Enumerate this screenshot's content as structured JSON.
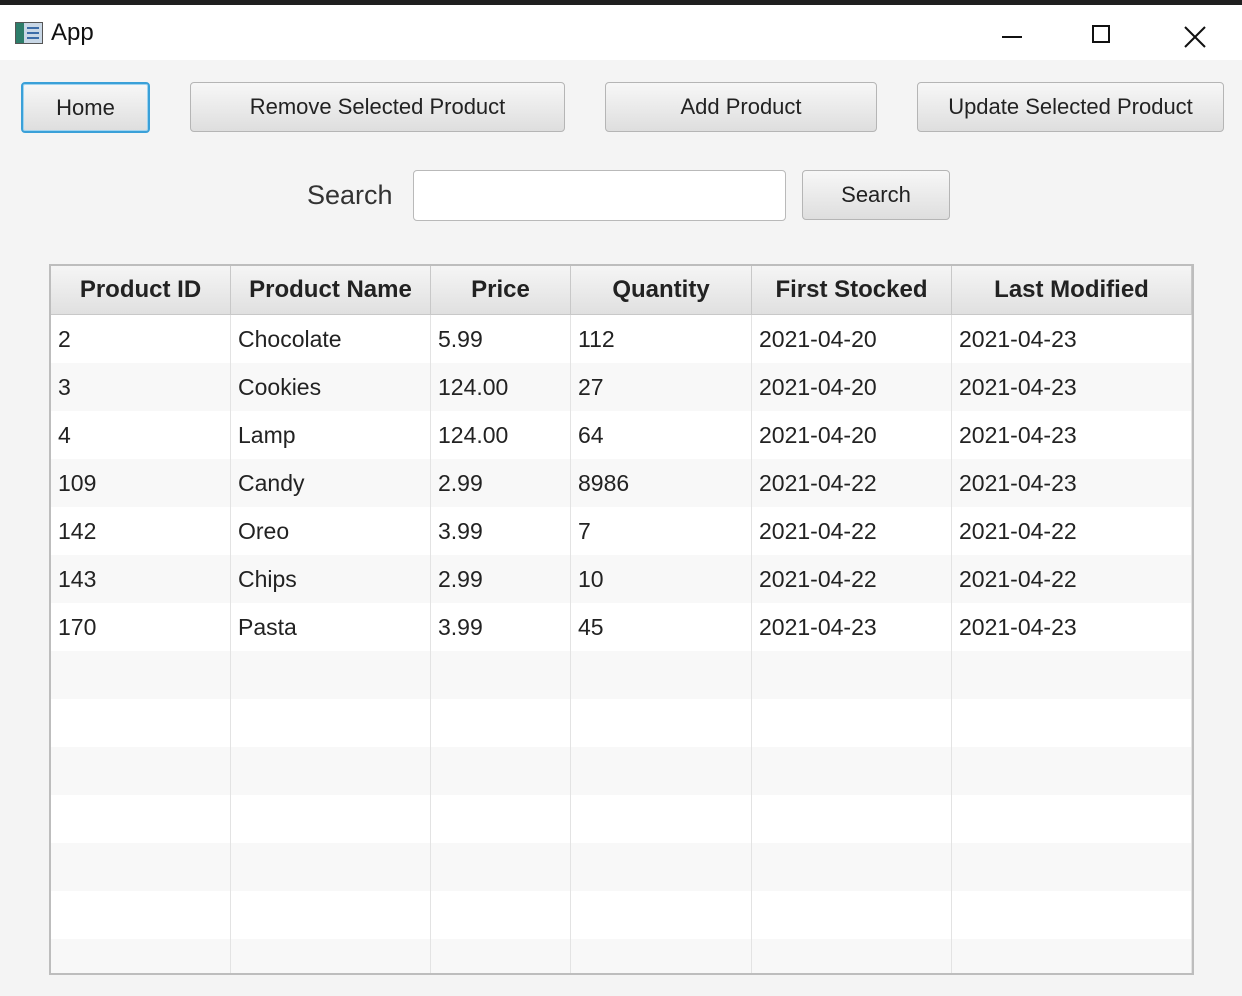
{
  "window": {
    "title": "App",
    "controls": {
      "minimize": "minimize",
      "maximize": "maximize",
      "close": "close"
    }
  },
  "toolbar": {
    "home_label": "Home",
    "remove_label": "Remove Selected Product",
    "add_label": "Add Product",
    "update_label": "Update Selected Product"
  },
  "search": {
    "label": "Search",
    "value": "",
    "placeholder": "",
    "button_label": "Search"
  },
  "table": {
    "columns": [
      "Product ID",
      "Product Name",
      "Price",
      "Quantity",
      "First Stocked",
      "Last Modified"
    ],
    "rows": [
      [
        "2",
        "Chocolate",
        "5.99",
        "112",
        "2021-04-20",
        "2021-04-23"
      ],
      [
        "3",
        "Cookies",
        "124.00",
        "27",
        "2021-04-20",
        "2021-04-23"
      ],
      [
        "4",
        "Lamp",
        "124.00",
        "64",
        "2021-04-20",
        "2021-04-23"
      ],
      [
        "109",
        "Candy",
        "2.99",
        "8986",
        "2021-04-22",
        "2021-04-23"
      ],
      [
        "142",
        "Oreo",
        "3.99",
        "7",
        "2021-04-22",
        "2021-04-22"
      ],
      [
        "143",
        "Chips",
        "2.99",
        "10",
        "2021-04-22",
        "2021-04-22"
      ],
      [
        "170",
        "Pasta",
        "3.99",
        "45",
        "2021-04-23",
        "2021-04-23"
      ]
    ]
  },
  "colors": {
    "focus_border": "#3aa0d8",
    "background": "#f4f4f4",
    "title_bar": "#ffffff"
  },
  "icons": {
    "app": "app-icon",
    "minimize": "minimize-icon",
    "maximize": "maximize-icon",
    "close": "close-icon"
  }
}
